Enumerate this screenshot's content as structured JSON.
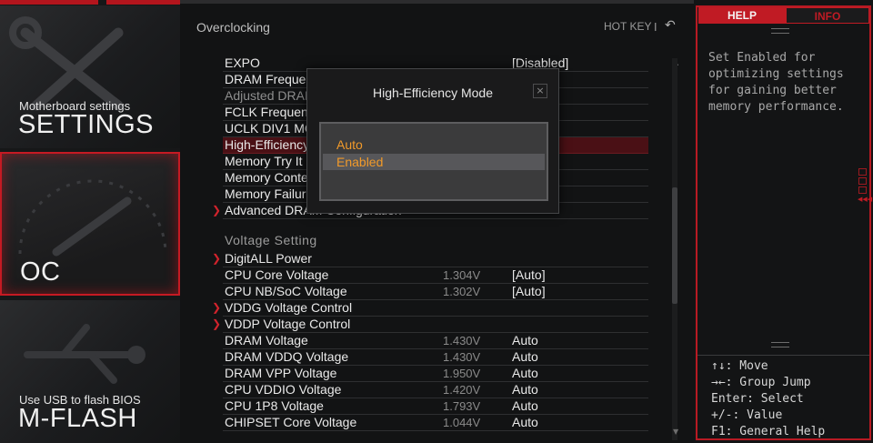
{
  "nav": {
    "settings": {
      "subtitle": "Motherboard settings",
      "title": "SETTINGS"
    },
    "oc": {
      "title": "OC"
    },
    "mflash": {
      "subtitle": "Use USB to flash BIOS",
      "title": "M-FLASH"
    }
  },
  "header": {
    "title": "Overclocking",
    "hotkey": "HOT KEY",
    "separator": "I",
    "back_icon": "back-arrow-icon"
  },
  "rows": [
    {
      "label": "EXPO",
      "value": "[Disabled]"
    },
    {
      "label": "DRAM Frequency",
      "value": ""
    },
    {
      "label": "Adjusted DRAM Frequency",
      "value": ""
    },
    {
      "label": "FCLK Frequency",
      "value": ""
    },
    {
      "label": "UCLK DIV1 MODE",
      "value": ""
    },
    {
      "label": "High-Efficiency Mode",
      "value": ""
    },
    {
      "label": "Memory Try It !",
      "value": "d]"
    },
    {
      "label": "Memory Context Restore",
      "value": ""
    },
    {
      "label": "Memory Failure Retry",
      "value": ""
    },
    {
      "label": "Advanced DRAM Configuration",
      "value": ""
    }
  ],
  "voltage": {
    "section": "Voltage Setting",
    "rows": [
      {
        "label": "DigitALL Power",
        "current": "",
        "value": ""
      },
      {
        "label": "CPU Core Voltage",
        "current": "1.304V",
        "value": "[Auto]"
      },
      {
        "label": "CPU NB/SoC Voltage",
        "current": "1.302V",
        "value": "[Auto]"
      },
      {
        "label": "VDDG Voltage Control",
        "current": "",
        "value": ""
      },
      {
        "label": "VDDP Voltage Control",
        "current": "",
        "value": ""
      },
      {
        "label": "DRAM Voltage",
        "current": "1.430V",
        "value": "Auto"
      },
      {
        "label": "DRAM VDDQ Voltage",
        "current": "1.430V",
        "value": "Auto"
      },
      {
        "label": "DRAM VPP Voltage",
        "current": "1.950V",
        "value": "Auto"
      },
      {
        "label": "CPU VDDIO Voltage",
        "current": "1.420V",
        "value": "Auto"
      },
      {
        "label": "CPU 1P8 Voltage",
        "current": "1.793V",
        "value": "Auto"
      },
      {
        "label": "CHIPSET Core Voltage",
        "current": "1.044V",
        "value": "Auto"
      }
    ]
  },
  "popup": {
    "title": "High-Efficiency Mode",
    "close": "×",
    "options": [
      "Auto",
      "Enabled"
    ],
    "selected": "Enabled"
  },
  "right": {
    "tabs": {
      "help": "HELP",
      "info": "INFO"
    },
    "help_text": "Set Enabled for optimizing settings for gaining better memory performance.",
    "keys": [
      "↑↓: Move",
      "→←: Group Jump",
      "Enter: Select",
      "+/-: Value",
      "F1: General Help"
    ]
  },
  "colors": {
    "accent": "#c01b24",
    "option": "#f19a2a",
    "panel": "#121314"
  }
}
